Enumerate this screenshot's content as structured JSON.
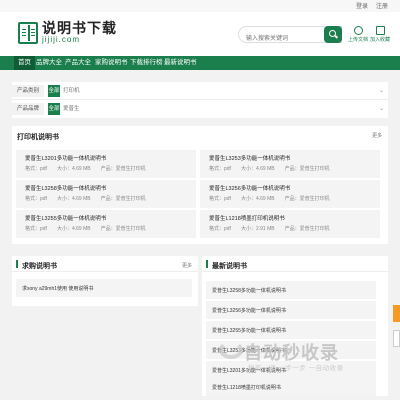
{
  "topbar": {
    "login": "登录",
    "register": "注册"
  },
  "logo": {
    "title": "说明书下载",
    "domain": "jijiji.com"
  },
  "search": {
    "placeholder": "输入搜索关键词"
  },
  "header_icons": {
    "upload": "上传文档",
    "favorite": "加入收藏"
  },
  "nav": {
    "items": [
      "首页",
      "品牌大全",
      "产品大全",
      "家购说明书",
      "下载排行榜",
      "最新说明书"
    ],
    "active": 0
  },
  "filters": {
    "category": {
      "label": "产品类别",
      "all": "全部",
      "value": "打印机"
    },
    "brand": {
      "label": "产品品牌",
      "all": "全部",
      "value": "爱普生"
    }
  },
  "printer_section": {
    "title": "打印机说明书",
    "more": "更多",
    "items": [
      {
        "title": "爱普生L3201多功能一体机说明书",
        "meta": "格式：pdf　　大小：4.69 MB　　产品：爱普生打印机"
      },
      {
        "title": "爱普生L3253多功能一体机说明书",
        "meta": "格式：pdf　　大小：4.69 MB　　产品：爱普生打印机"
      },
      {
        "title": "爱普生L3258多功能一体机说明书",
        "meta": "格式：pdf　　大小：4.69 MB　　产品：爱普生打印机"
      },
      {
        "title": "爱普生L3256多功能一体机说明书",
        "meta": "格式：pdf　　大小：4.69 MB　　产品：爱普生打印机"
      },
      {
        "title": "爱普生L3255多功能一体机说明书",
        "meta": "格式：pdf　　大小：4.69 MB　　产品：爱普生打印机"
      },
      {
        "title": "爱普生L1218喷墨打印机说明书",
        "meta": "格式：pdf　　大小：2.91 MB　　产品：爱普生打印机"
      }
    ]
  },
  "buy_section": {
    "title": "求购说明书",
    "more": "更多",
    "items": [
      "求sony a29mh1使用 使用说明书"
    ]
  },
  "latest_section": {
    "title": "最新说明书",
    "items": [
      "爱普生L3258多功能一体机说明书",
      "爱普生L3256多功能一体机说明书",
      "爱普生L3255多功能一体机说明书",
      "爱普生L3253多功能一体机说明书",
      "爱普生L3201多功能一体机说明书",
      "爱普生L1218喷墨打印机说明书"
    ]
  },
  "watermark": {
    "main": "自动秒收录",
    "sub": "智能一键 一步一步 一自动收录"
  },
  "colors": {
    "brand": "#1b7f4d",
    "nav_active": "#0f5c36",
    "side_button": "#f59c28"
  }
}
